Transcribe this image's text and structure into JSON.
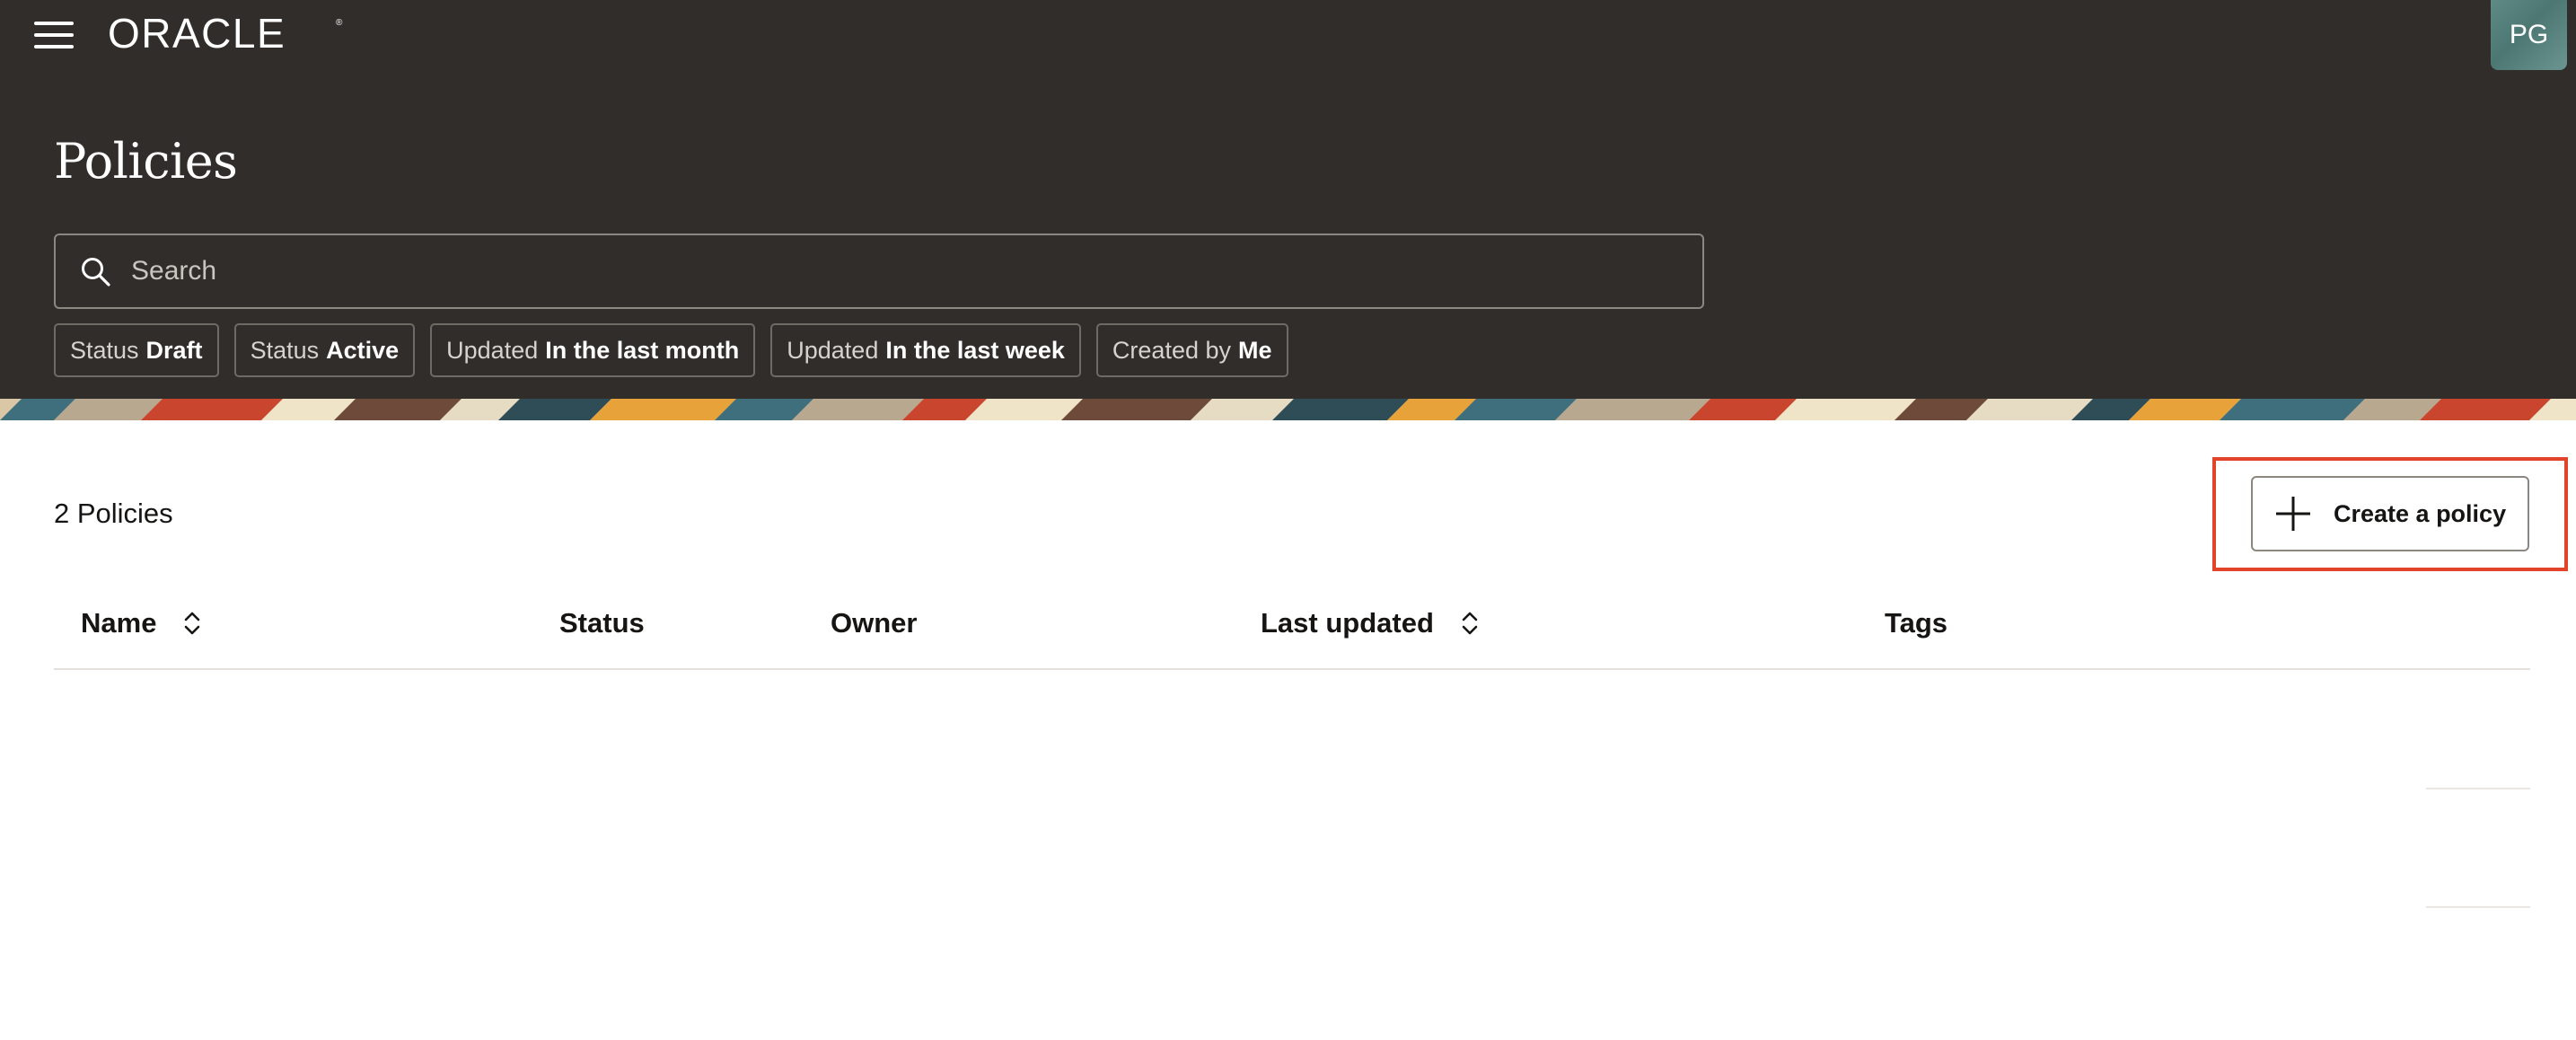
{
  "header": {
    "logo_text": "ORACLE",
    "avatar_initials": "PG",
    "page_title": "Policies",
    "search": {
      "placeholder": "Search",
      "value": ""
    },
    "filters": [
      {
        "label": "Status",
        "value": "Draft"
      },
      {
        "label": "Status",
        "value": "Active"
      },
      {
        "label": "Updated",
        "value": "In the last month"
      },
      {
        "label": "Updated",
        "value": "In the last week"
      },
      {
        "label": "Created by",
        "value": "Me"
      }
    ]
  },
  "main": {
    "policy_count": "2 Policies",
    "create_button_label": "Create a policy",
    "table": {
      "columns": [
        "Name",
        "Status",
        "Owner",
        "Last updated",
        "Tags"
      ],
      "rows": []
    }
  },
  "colors": {
    "header_bg": "#312d2a",
    "highlight": "#e2432b",
    "avatar": "#5f8a86"
  },
  "icons": {
    "menu": "hamburger-menu-icon",
    "search": "search-icon",
    "add": "plus-icon",
    "sort": "sort-arrows-icon"
  }
}
